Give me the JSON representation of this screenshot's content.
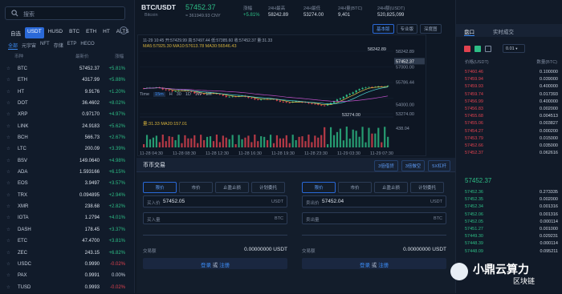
{
  "search": {
    "placeholder": "搜索"
  },
  "quote_tabs": [
    "自选",
    "USDT",
    "HUSD",
    "BTC",
    "ETH",
    "HT",
    "ALTS"
  ],
  "coin_tabs": [
    "全部",
    "元宇宙",
    "NFT",
    "存储",
    "ETP",
    "HECO"
  ],
  "list_header": {
    "pair": "币种",
    "price": "最新价",
    "change": "涨幅"
  },
  "coins": [
    {
      "name": "BTC",
      "price": "57452.37",
      "change": "+5.81%",
      "dir": "up"
    },
    {
      "name": "ETH",
      "price": "4317.99",
      "change": "+5.88%",
      "dir": "up"
    },
    {
      "name": "HT",
      "price": "9.9176",
      "change": "+1.20%",
      "dir": "up"
    },
    {
      "name": "DOT",
      "price": "36.4602",
      "change": "+8.02%",
      "dir": "up"
    },
    {
      "name": "XRP",
      "price": "0.97170",
      "change": "+4.97%",
      "dir": "up"
    },
    {
      "name": "LINK",
      "price": "24.9183",
      "change": "+5.62%",
      "dir": "up"
    },
    {
      "name": "BCH",
      "price": "566.73",
      "change": "+2.67%",
      "dir": "up"
    },
    {
      "name": "LTC",
      "price": "200.09",
      "change": "+3.39%",
      "dir": "up"
    },
    {
      "name": "BSV",
      "price": "149.0640",
      "change": "+4.98%",
      "dir": "up"
    },
    {
      "name": "ADA",
      "price": "1.593166",
      "change": "+6.15%",
      "dir": "up"
    },
    {
      "name": "EOS",
      "price": "3.9497",
      "change": "+3.57%",
      "dir": "up"
    },
    {
      "name": "TRX",
      "price": "0.094895",
      "change": "+2.94%",
      "dir": "up"
    },
    {
      "name": "XMR",
      "price": "238.68",
      "change": "+2.82%",
      "dir": "up"
    },
    {
      "name": "IOTA",
      "price": "1.2794",
      "change": "+4.01%",
      "dir": "up"
    },
    {
      "name": "DASH",
      "price": "178.45",
      "change": "+3.37%",
      "dir": "up"
    },
    {
      "name": "ETC",
      "price": "47.4700",
      "change": "+3.81%",
      "dir": "up"
    },
    {
      "name": "ZEC",
      "price": "243.15",
      "change": "+6.82%",
      "dir": "up"
    },
    {
      "name": "USDC",
      "price": "0.9990",
      "change": "-0.02%",
      "dir": "dn"
    },
    {
      "name": "PAX",
      "price": "0.9991",
      "change": "0.00%",
      "dir": "flat"
    },
    {
      "name": "TUSD",
      "price": "0.9993",
      "change": "-0.02%",
      "dir": "dn"
    }
  ],
  "ticker": {
    "pair": "BTC/USDT",
    "sub": "Bitcoin",
    "last": "57452.37",
    "cny": "≈ 361949.93 CNY",
    "change_label": "涨幅",
    "change": "+5.81%",
    "high_label": "24H最高",
    "high": "58242.89",
    "low_label": "24H最低",
    "low": "53274.00",
    "vol_label": "24H量(BTC)",
    "vol": "9,401",
    "amt_label": "24H额(USDT)",
    "amt": "520,825,099"
  },
  "chart_buttons": [
    "基本版",
    "专业版",
    "深度图"
  ],
  "intervals": [
    "Time",
    "15m",
    "H",
    "30",
    "1D",
    "1W",
    "1M"
  ],
  "chart_info": {
    "ohlc": "11-29 10:45  开:57429.99  高:57497.44  低:57385.60  收:57452.37  量:31.33",
    "ma": "MA5:57925.30  MA10:57613.78  MA30:56546.43",
    "vol_info": "量:31.33  MA20:157.01"
  },
  "chart_data": {
    "type": "candlestick",
    "price_axis": [
      "58242.89",
      "57452.37",
      "57000.00",
      "55786.44",
      "54000.00",
      "53274.00"
    ],
    "high_mark": "58242.89",
    "low_mark": "53274.00",
    "volume_axis": [
      "438.04"
    ],
    "time_axis": [
      "11-28 04:30",
      "11-28 08:30",
      "11-28 12:30",
      "11-28 16:30",
      "11-28 19:30",
      "11-28 23:30",
      "11-29 03:30",
      "11-29 07:30"
    ]
  },
  "trade": {
    "title": "币币交易",
    "tabs": [
      "3倍借贷",
      "3倍做空",
      "5X杠杆"
    ],
    "order_types": [
      "限价",
      "市价",
      "止盈止损",
      "计划委托"
    ],
    "buy": {
      "price_label": "买入价",
      "price": "57452.05",
      "unit": "USDT",
      "amount_label": "买入量",
      "amount_unit": "BTC",
      "total_label": "交易额",
      "total": "0.00000000 USDT",
      "login": "登录",
      "or": "或",
      "register": "注册"
    },
    "sell": {
      "price_label": "卖出价",
      "price": "57452.04",
      "unit": "USDT",
      "amount_label": "卖出量",
      "amount_unit": "BTC",
      "total_label": "交易额",
      "total": "0.00000000 USDT",
      "login": "登录",
      "or": "或",
      "register": "注册"
    }
  },
  "orderbook": {
    "tabs": [
      "盘口",
      "实时成交"
    ],
    "depth": "0.01",
    "col_price": "价格(USDT)",
    "col_amount": "数量(BTC)",
    "asks": [
      {
        "p": "57460.46",
        "a": "0.100000"
      },
      {
        "p": "57459.94",
        "a": "0.039000"
      },
      {
        "p": "57459.93",
        "a": "0.400000"
      },
      {
        "p": "57459.74",
        "a": "0.017393"
      },
      {
        "p": "57456.99",
        "a": "0.400000"
      },
      {
        "p": "57456.83",
        "a": "0.002000"
      },
      {
        "p": "57455.68",
        "a": "0.004513"
      },
      {
        "p": "57455.06",
        "a": "0.003827"
      },
      {
        "p": "57454.27",
        "a": "0.000200"
      },
      {
        "p": "57453.79",
        "a": "0.015000"
      },
      {
        "p": "57452.66",
        "a": "0.035000"
      },
      {
        "p": "57452.37",
        "a": "0.062616"
      }
    ],
    "mid": "57452.37",
    "bids": [
      {
        "p": "57452.36",
        "a": "0.273335"
      },
      {
        "p": "57452.35",
        "a": "0.002000"
      },
      {
        "p": "57452.34",
        "a": "0.001316"
      },
      {
        "p": "57452.06",
        "a": "0.001316"
      },
      {
        "p": "57452.05",
        "a": "0.000114"
      },
      {
        "p": "57451.27",
        "a": "0.001000"
      },
      {
        "p": "57449.30",
        "a": "0.029231"
      },
      {
        "p": "57448.39",
        "a": "0.000114"
      },
      {
        "p": "57448.09",
        "a": "0.095211"
      }
    ]
  },
  "watermark": {
    "text": "小鼎云算力",
    "sub": "区块链"
  },
  "colors": {
    "up": "#2dbd85",
    "down": "#e0424f",
    "accent": "#2a69d8"
  }
}
